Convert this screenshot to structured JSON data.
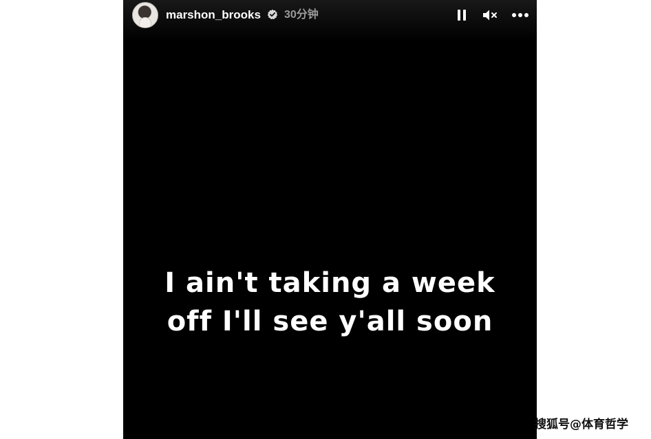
{
  "story": {
    "username": "marshon_brooks",
    "verified_icon": "verified-badge-icon",
    "timestamp": "30分钟",
    "controls": {
      "pause_icon": "pause-icon",
      "mute_icon": "speaker-muted-icon",
      "more_icon": "more-horizontal-icon"
    },
    "caption": {
      "line1": "I ain't taking a week",
      "line2": "off I'll see y'all soon"
    },
    "background_color": "#000000",
    "text_color": "#ffffff"
  },
  "watermark": {
    "text": "搜狐号@体育哲学"
  }
}
